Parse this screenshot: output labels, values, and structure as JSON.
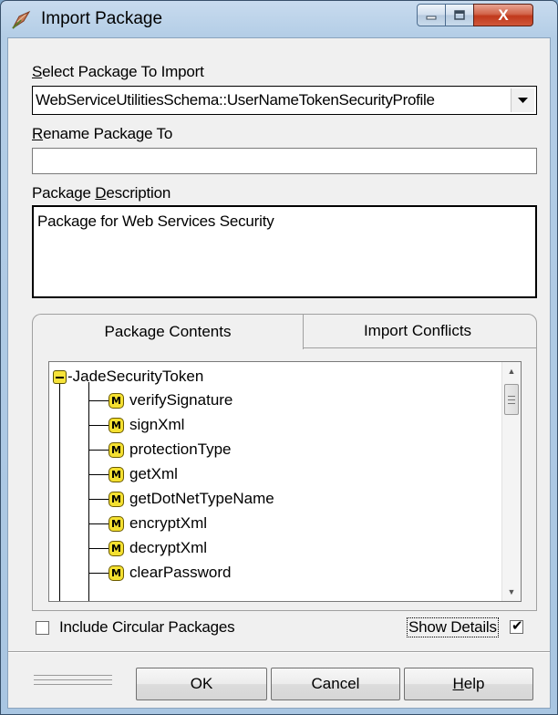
{
  "window": {
    "title": "Import Package",
    "close_symbol": "X"
  },
  "select_package": {
    "label": "Select Package To Import",
    "label_access": "S",
    "label_rest": "elect Package To Import",
    "value": "WebServiceUtilitiesSchema::UserNameTokenSecurityProfile"
  },
  "rename_package": {
    "label_access": "R",
    "label_rest": "ename Package To",
    "value": ""
  },
  "package_description": {
    "label_pre": "Package ",
    "label_access": "D",
    "label_rest": "escription",
    "value": "Package for Web Services Security"
  },
  "tabs": [
    {
      "label": "Package Contents",
      "active": true
    },
    {
      "label": "Import Conflicts",
      "active": false
    }
  ],
  "tree": {
    "root": "-JadeSecurityToken",
    "method_badge": "M",
    "items": [
      "verifySignature",
      "signXml",
      "protectionType",
      "getXml",
      "getDotNetTypeName",
      "encryptXml",
      "decryptXml",
      "clearPassword"
    ]
  },
  "include_circular": {
    "label": "Include Circular Packages",
    "checked": false
  },
  "show_details": {
    "label": "Show Details",
    "checked": true
  },
  "buttons": {
    "ok": "OK",
    "cancel": "Cancel",
    "help_access": "H",
    "help_rest": "elp"
  },
  "colors": {
    "accent": "#f4e030",
    "close": "#c0391c"
  }
}
